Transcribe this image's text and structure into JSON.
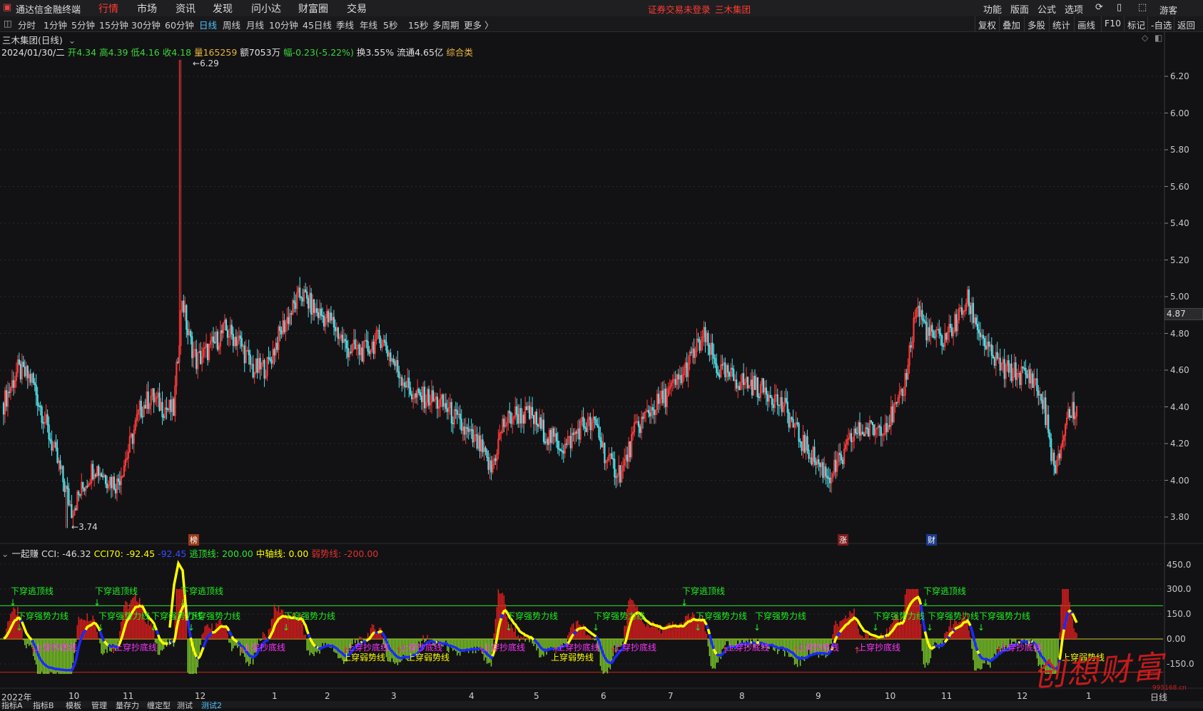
{
  "app": {
    "logo_text": "通达信金融终端",
    "login_status": "证券交易未登录",
    "stock_short": "三木集团",
    "guest": "游客"
  },
  "menu": [
    "行情",
    "市场",
    "资讯",
    "发现",
    "问小达",
    "财富圈",
    "交易"
  ],
  "menu_active": "行情",
  "right_menu": [
    "功能",
    "版面",
    "公式",
    "选项"
  ],
  "periods": [
    "分时",
    "1分钟",
    "5分钟",
    "15分钟",
    "30分钟",
    "60分钟",
    "日线",
    "周线",
    "月线",
    "10分钟",
    "45日线",
    "季线",
    "年线",
    "5秒",
    "15秒",
    "多周期",
    "更多 〉"
  ],
  "period_selected": "日线",
  "tools": [
    "复权",
    "叠加",
    "多股",
    "统计",
    "画线",
    "F10",
    "标记",
    "-自选",
    "返回"
  ],
  "chart_header": {
    "title": "三木集团(日线)",
    "date": "2024/01/30/二",
    "open": "开4.34",
    "high": "高4.39",
    "low": "低4.16",
    "close": "收4.18",
    "volume": "量165259",
    "amount": "额7053万",
    "change": "幅-0.23(-5.22%)",
    "turnover": "换3.55%",
    "float": "流通4.65亿",
    "sector": "综合类"
  },
  "price_axis": {
    "ticks": [
      "6.20",
      "6.00",
      "5.80",
      "5.60",
      "5.40",
      "5.20",
      "5.00",
      "4.80",
      "4.60",
      "4.40",
      "4.20",
      "4.00",
      "3.80"
    ],
    "current_tag": "4.87",
    "max_label": "6.29",
    "min_label": "3.74"
  },
  "event_markers": [
    "榜",
    "涨",
    "财"
  ],
  "indicator": {
    "name": "一起赚",
    "cci_label": "CCI: ",
    "cci": "-46.32",
    "cci70_label": "CCI70: ",
    "cci70": "-92.45",
    "blue_value": "-92.45",
    "escape_label": "逃顶线: ",
    "escape": "200.00",
    "mid_label": "中轴线: ",
    "mid": "0.00",
    "weak_label": "弱势线: ",
    "weak": "-200.00",
    "axis_ticks": [
      "450.0",
      "300.0",
      "150.0",
      "0.00",
      "-150.0"
    ],
    "signal_labels": [
      "下穿逃顶线",
      "下穿强势力线",
      "上穿抄底线",
      "上穿弱势线"
    ]
  },
  "time_axis": [
    "2022年",
    "10",
    "11",
    "12",
    "1",
    "2",
    "3",
    "4",
    "5",
    "6",
    "7",
    "8",
    "9",
    "10",
    "11",
    "12",
    "1"
  ],
  "time_axis_right": "日线",
  "bottom_tabs": [
    "指标A",
    "指标B",
    "模板",
    "管理",
    "量存力",
    "缠定型",
    "测试",
    "测试2"
  ],
  "watermark": {
    "text": "创想财富",
    "site": "995168.cn"
  },
  "colors": {
    "up": "#ff3b3b",
    "down": "#54e0ea",
    "escape_line": "#2ee62e",
    "weak_line": "#d62020",
    "cci_yellow": "#ffff00",
    "cci_blue": "#1b2bff",
    "signal_green": "#22ee22",
    "signal_magenta": "#ff33ff"
  }
}
